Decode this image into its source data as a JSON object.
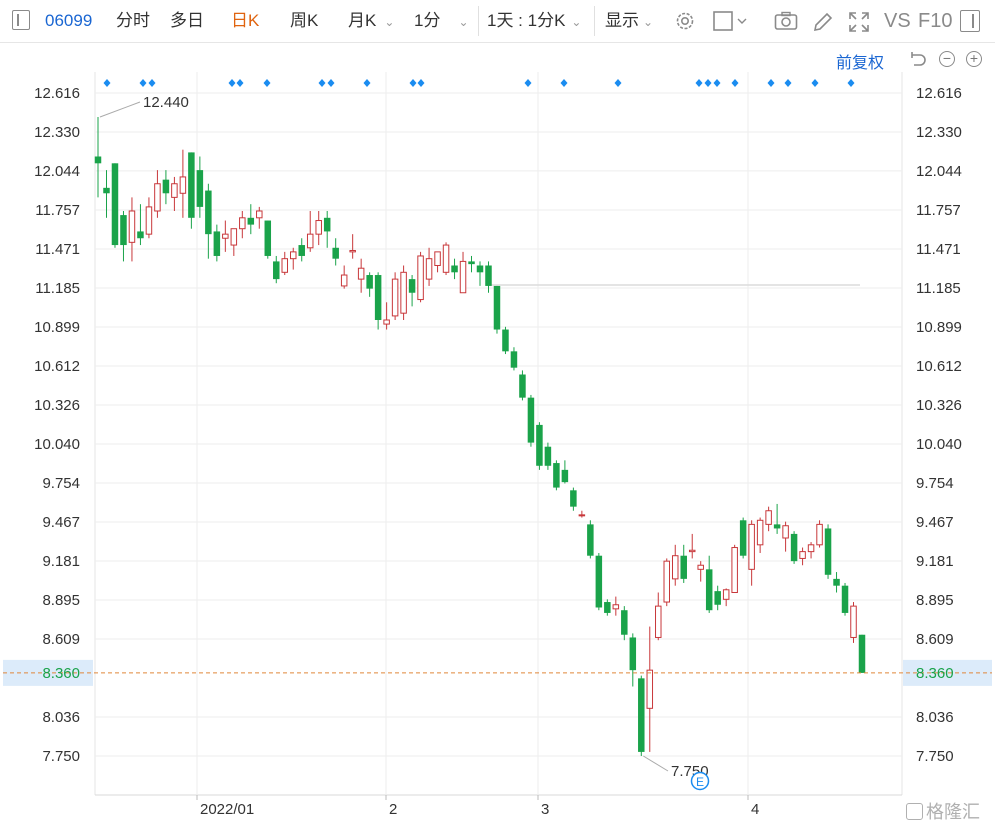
{
  "toolbar": {
    "code": "06099",
    "tabs": [
      "分时",
      "多日",
      "日K",
      "周K"
    ],
    "month_k": "月K",
    "period": "1分",
    "range": "1天 : 1分K",
    "display": "显示",
    "vs": "VS",
    "f10": "F10"
  },
  "subtoolbar": {
    "adjust": "前复权"
  },
  "colors": {
    "up": "#c8373a",
    "down": "#1aa34a",
    "accent": "#1a66d2",
    "active_tab": "#e06410",
    "price_line": "#e0863a",
    "marker": "#1a8cf0"
  },
  "icons": [
    "settings-icon",
    "checkbox-icon",
    "camera-icon",
    "pencil-icon",
    "expand-icon",
    "panel-icon",
    "undo-icon",
    "zoom-out-icon",
    "zoom-in-icon"
  ],
  "watermark": "格隆汇",
  "chart_data": {
    "type": "candlestick",
    "y_ticks": [
      "12.616",
      "12.330",
      "12.044",
      "11.757",
      "11.471",
      "11.185",
      "10.899",
      "10.612",
      "10.326",
      "10.040",
      "9.754",
      "9.467",
      "9.181",
      "8.895",
      "8.609",
      "8.036",
      "7.750"
    ],
    "ylim": [
      7.75,
      12.616
    ],
    "x_labels": [
      "2022/01",
      "2",
      "3",
      "4"
    ],
    "last_price": "8.360",
    "high_label": "12.440",
    "low_label": "7.750",
    "event_marker": "E",
    "grid": true,
    "candles": [
      {
        "o": 12.15,
        "h": 12.44,
        "l": 11.85,
        "c": 12.1
      },
      {
        "o": 11.92,
        "h": 12.05,
        "l": 11.7,
        "c": 11.88
      },
      {
        "o": 12.1,
        "h": 12.1,
        "l": 11.48,
        "c": 11.5
      },
      {
        "o": 11.72,
        "h": 11.75,
        "l": 11.38,
        "c": 11.5
      },
      {
        "o": 11.52,
        "h": 11.85,
        "l": 11.38,
        "c": 11.75
      },
      {
        "o": 11.6,
        "h": 11.8,
        "l": 11.5,
        "c": 11.55
      },
      {
        "o": 11.58,
        "h": 11.85,
        "l": 11.55,
        "c": 11.78
      },
      {
        "o": 11.75,
        "h": 12.05,
        "l": 11.7,
        "c": 11.95
      },
      {
        "o": 11.98,
        "h": 12.05,
        "l": 11.8,
        "c": 11.88
      },
      {
        "o": 11.85,
        "h": 12.0,
        "l": 11.75,
        "c": 11.95
      },
      {
        "o": 11.88,
        "h": 12.2,
        "l": 11.7,
        "c": 12.0
      },
      {
        "o": 12.18,
        "h": 12.18,
        "l": 11.62,
        "c": 11.7
      },
      {
        "o": 12.05,
        "h": 12.15,
        "l": 11.7,
        "c": 11.78
      },
      {
        "o": 11.9,
        "h": 11.95,
        "l": 11.4,
        "c": 11.58
      },
      {
        "o": 11.6,
        "h": 11.65,
        "l": 11.38,
        "c": 11.42
      },
      {
        "o": 11.55,
        "h": 11.68,
        "l": 11.45,
        "c": 11.58
      },
      {
        "o": 11.5,
        "h": 11.6,
        "l": 11.42,
        "c": 11.62
      },
      {
        "o": 11.62,
        "h": 11.75,
        "l": 11.55,
        "c": 11.7
      },
      {
        "o": 11.7,
        "h": 11.8,
        "l": 11.58,
        "c": 11.65
      },
      {
        "o": 11.7,
        "h": 11.78,
        "l": 11.62,
        "c": 11.75
      },
      {
        "o": 11.68,
        "h": 11.68,
        "l": 11.4,
        "c": 11.42
      },
      {
        "o": 11.38,
        "h": 11.42,
        "l": 11.22,
        "c": 11.25
      },
      {
        "o": 11.3,
        "h": 11.45,
        "l": 11.28,
        "c": 11.4
      },
      {
        "o": 11.4,
        "h": 11.48,
        "l": 11.32,
        "c": 11.45
      },
      {
        "o": 11.5,
        "h": 11.55,
        "l": 11.38,
        "c": 11.42
      },
      {
        "o": 11.48,
        "h": 11.75,
        "l": 11.45,
        "c": 11.58
      },
      {
        "o": 11.58,
        "h": 11.75,
        "l": 11.5,
        "c": 11.68
      },
      {
        "o": 11.7,
        "h": 11.75,
        "l": 11.48,
        "c": 11.6
      },
      {
        "o": 11.48,
        "h": 11.55,
        "l": 11.35,
        "c": 11.4
      },
      {
        "o": 11.2,
        "h": 11.35,
        "l": 11.18,
        "c": 11.28
      },
      {
        "o": 11.45,
        "h": 11.58,
        "l": 11.4,
        "c": 11.46
      },
      {
        "o": 11.25,
        "h": 11.4,
        "l": 11.15,
        "c": 11.33
      },
      {
        "o": 11.28,
        "h": 11.3,
        "l": 11.12,
        "c": 11.18
      },
      {
        "o": 11.28,
        "h": 11.3,
        "l": 10.88,
        "c": 10.95
      },
      {
        "o": 10.92,
        "h": 11.08,
        "l": 10.88,
        "c": 10.95
      },
      {
        "o": 10.98,
        "h": 11.3,
        "l": 10.95,
        "c": 11.25
      },
      {
        "o": 11.0,
        "h": 11.35,
        "l": 10.95,
        "c": 11.3
      },
      {
        "o": 11.25,
        "h": 11.28,
        "l": 11.05,
        "c": 11.15
      },
      {
        "o": 11.1,
        "h": 11.45,
        "l": 11.08,
        "c": 11.42
      },
      {
        "o": 11.25,
        "h": 11.48,
        "l": 11.2,
        "c": 11.4
      },
      {
        "o": 11.35,
        "h": 11.45,
        "l": 11.3,
        "c": 11.45
      },
      {
        "o": 11.3,
        "h": 11.52,
        "l": 11.28,
        "c": 11.5
      },
      {
        "o": 11.35,
        "h": 11.4,
        "l": 11.25,
        "c": 11.3
      },
      {
        "o": 11.15,
        "h": 11.45,
        "l": 11.15,
        "c": 11.38
      },
      {
        "o": 11.38,
        "h": 11.42,
        "l": 11.3,
        "c": 11.36
      },
      {
        "o": 11.35,
        "h": 11.38,
        "l": 11.2,
        "c": 11.3
      },
      {
        "o": 11.35,
        "h": 11.38,
        "l": 11.15,
        "c": 11.2
      },
      {
        "o": 11.2,
        "h": 11.2,
        "l": 10.85,
        "c": 10.88
      },
      {
        "o": 10.88,
        "h": 10.9,
        "l": 10.7,
        "c": 10.72
      },
      {
        "o": 10.72,
        "h": 10.75,
        "l": 10.58,
        "c": 10.6
      },
      {
        "o": 10.55,
        "h": 10.58,
        "l": 10.36,
        "c": 10.38
      },
      {
        "o": 10.38,
        "h": 10.4,
        "l": 10.02,
        "c": 10.05
      },
      {
        "o": 10.18,
        "h": 10.2,
        "l": 9.85,
        "c": 9.88
      },
      {
        "o": 10.02,
        "h": 10.05,
        "l": 9.85,
        "c": 9.88
      },
      {
        "o": 9.9,
        "h": 9.92,
        "l": 9.7,
        "c": 9.72
      },
      {
        "o": 9.85,
        "h": 9.92,
        "l": 9.75,
        "c": 9.76
      },
      {
        "o": 9.7,
        "h": 9.72,
        "l": 9.55,
        "c": 9.58
      },
      {
        "o": 9.52,
        "h": 9.55,
        "l": 9.5,
        "c": 9.52
      },
      {
        "o": 9.45,
        "h": 9.48,
        "l": 9.2,
        "c": 9.22
      },
      {
        "o": 9.22,
        "h": 9.24,
        "l": 8.82,
        "c": 8.84
      },
      {
        "o": 8.88,
        "h": 8.9,
        "l": 8.78,
        "c": 8.8
      },
      {
        "o": 8.83,
        "h": 8.92,
        "l": 8.78,
        "c": 8.86
      },
      {
        "o": 8.82,
        "h": 8.85,
        "l": 8.6,
        "c": 8.64
      },
      {
        "o": 8.62,
        "h": 8.65,
        "l": 8.26,
        "c": 8.38
      },
      {
        "o": 8.32,
        "h": 8.34,
        "l": 7.75,
        "c": 7.78
      },
      {
        "o": 8.1,
        "h": 8.7,
        "l": 7.78,
        "c": 8.38
      },
      {
        "o": 8.62,
        "h": 8.95,
        "l": 8.6,
        "c": 8.85
      },
      {
        "o": 8.88,
        "h": 9.2,
        "l": 8.85,
        "c": 9.18
      },
      {
        "o": 9.05,
        "h": 9.3,
        "l": 9.0,
        "c": 9.22
      },
      {
        "o": 9.22,
        "h": 9.3,
        "l": 9.02,
        "c": 9.05
      },
      {
        "o": 9.25,
        "h": 9.38,
        "l": 9.2,
        "c": 9.26
      },
      {
        "o": 9.12,
        "h": 9.18,
        "l": 9.03,
        "c": 9.15
      },
      {
        "o": 9.12,
        "h": 9.22,
        "l": 8.8,
        "c": 8.82
      },
      {
        "o": 8.96,
        "h": 9.0,
        "l": 8.82,
        "c": 8.86
      },
      {
        "o": 8.9,
        "h": 8.98,
        "l": 8.85,
        "c": 8.97
      },
      {
        "o": 8.95,
        "h": 9.3,
        "l": 8.95,
        "c": 9.28
      },
      {
        "o": 9.48,
        "h": 9.5,
        "l": 9.2,
        "c": 9.22
      },
      {
        "o": 9.12,
        "h": 9.48,
        "l": 9.0,
        "c": 9.45
      },
      {
        "o": 9.3,
        "h": 9.5,
        "l": 9.24,
        "c": 9.48
      },
      {
        "o": 9.45,
        "h": 9.58,
        "l": 9.4,
        "c": 9.55
      },
      {
        "o": 9.45,
        "h": 9.6,
        "l": 9.38,
        "c": 9.42
      },
      {
        "o": 9.35,
        "h": 9.47,
        "l": 9.25,
        "c": 9.44
      },
      {
        "o": 9.38,
        "h": 9.4,
        "l": 9.16,
        "c": 9.18
      },
      {
        "o": 9.2,
        "h": 9.28,
        "l": 9.15,
        "c": 9.25
      },
      {
        "o": 9.25,
        "h": 9.32,
        "l": 9.2,
        "c": 9.3
      },
      {
        "o": 9.3,
        "h": 9.48,
        "l": 9.28,
        "c": 9.45
      },
      {
        "o": 9.42,
        "h": 9.45,
        "l": 9.05,
        "c": 9.08
      },
      {
        "o": 9.05,
        "h": 9.1,
        "l": 8.95,
        "c": 9.0
      },
      {
        "o": 9.0,
        "h": 9.02,
        "l": 8.78,
        "c": 8.8
      },
      {
        "o": 8.62,
        "h": 8.88,
        "l": 8.58,
        "c": 8.85
      },
      {
        "o": 8.64,
        "h": 8.64,
        "l": 8.36,
        "c": 8.36
      }
    ]
  }
}
